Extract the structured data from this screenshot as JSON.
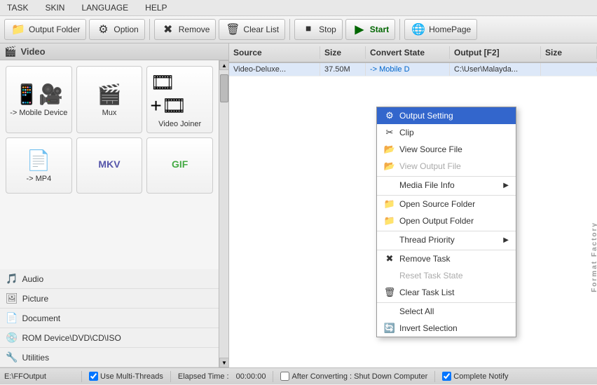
{
  "menubar": {
    "items": [
      "TASK",
      "SKIN",
      "LANGUAGE",
      "HELP"
    ]
  },
  "toolbar": {
    "buttons": [
      {
        "label": "Output Folder",
        "icon": "📁"
      },
      {
        "label": "Option",
        "icon": "⚙"
      },
      {
        "label": "Remove",
        "icon": "✖"
      },
      {
        "label": "Clear List",
        "icon": "🗑"
      },
      {
        "label": "Stop",
        "icon": "⏹"
      },
      {
        "label": "Start",
        "icon": "▶"
      },
      {
        "label": "HomePage",
        "icon": "🌐"
      }
    ]
  },
  "left_panel": {
    "title": "Video",
    "icon": "🎬",
    "grid_items": [
      {
        "label": "-> Mobile Device",
        "icon": "📱"
      },
      {
        "label": "Mux",
        "icon": "🎬"
      },
      {
        "label": "Video Joiner",
        "icon": "🎞"
      },
      {
        "label": "-> MP4",
        "icon": "📄"
      },
      {
        "label": "",
        "icon": "🎞"
      },
      {
        "label": "",
        "icon": "GIF"
      }
    ]
  },
  "categories": [
    {
      "label": "Audio",
      "icon": "🎵"
    },
    {
      "label": "Picture",
      "icon": "🖼"
    },
    {
      "label": "Document",
      "icon": "📄"
    },
    {
      "label": "ROM Device\\DVD\\CD\\ISO",
      "icon": "💿"
    },
    {
      "label": "Utilities",
      "icon": "🔧"
    }
  ],
  "table": {
    "headers": [
      "Source",
      "Size",
      "Convert State",
      "Output [F2]",
      "Size"
    ],
    "rows": [
      {
        "source": "Video-Deluxe...",
        "size": "37.50M",
        "state": "-> Mobile D",
        "output": "C:\\User\\Malayda...",
        "size2": ""
      }
    ]
  },
  "context_menu": {
    "items": [
      {
        "label": "Output Setting",
        "icon": "⚙",
        "type": "highlighted",
        "has_arrow": false
      },
      {
        "label": "Clip",
        "icon": "✂",
        "type": "normal",
        "has_arrow": false
      },
      {
        "label": "View Source File",
        "icon": "📂",
        "type": "normal",
        "has_arrow": false
      },
      {
        "label": "View Output File",
        "icon": "📂",
        "type": "disabled",
        "has_arrow": false
      },
      {
        "label": "Media File Info",
        "icon": "",
        "type": "normal separator",
        "has_arrow": true
      },
      {
        "label": "Open Source Folder",
        "icon": "📁",
        "type": "normal separator",
        "has_arrow": false
      },
      {
        "label": "Open Output Folder",
        "icon": "📁",
        "type": "normal",
        "has_arrow": false
      },
      {
        "label": "Thread Priority",
        "icon": "",
        "type": "normal separator",
        "has_arrow": true
      },
      {
        "label": "Remove Task",
        "icon": "✖",
        "type": "normal separator",
        "has_arrow": false
      },
      {
        "label": "Reset Task State",
        "icon": "",
        "type": "disabled",
        "has_arrow": false
      },
      {
        "label": "Clear Task List",
        "icon": "🗑",
        "type": "normal",
        "has_arrow": false
      },
      {
        "label": "Select All",
        "icon": "",
        "type": "normal separator",
        "has_arrow": false
      },
      {
        "label": "Invert Selection",
        "icon": "🔄",
        "type": "normal",
        "has_arrow": false
      }
    ]
  },
  "statusbar": {
    "path": "E:\\FFOutput",
    "checkbox_multithreads": "Use Multi-Threads",
    "elapsed_label": "Elapsed Time :",
    "elapsed_value": "00:00:00",
    "checkbox_shutdown": "After Converting : Shut Down Computer",
    "checkbox_notify": "Complete Notify"
  },
  "ff_label": "Format Factory"
}
